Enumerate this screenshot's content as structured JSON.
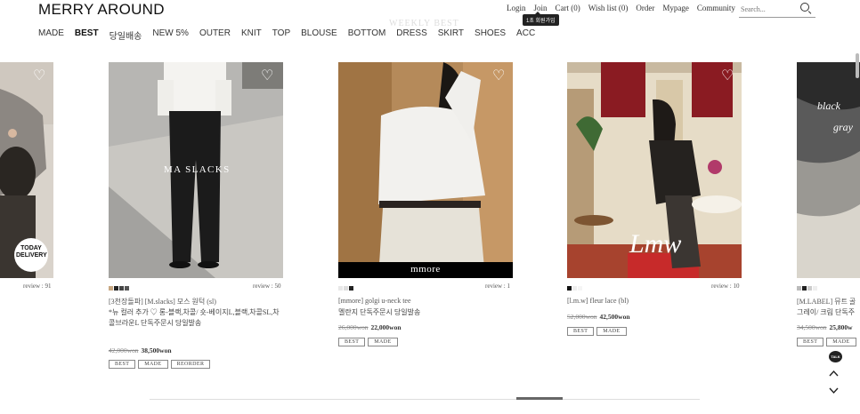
{
  "header": {
    "logo": "MERRY AROUND",
    "nav": [
      "MADE",
      "BEST",
      "당일배송",
      "NEW 5%",
      "OUTER",
      "KNIT",
      "TOP",
      "BLOUSE",
      "BOTTOM",
      "DRESS",
      "SKIRT",
      "SHOES",
      "ACC"
    ],
    "util": [
      "Login",
      "Join",
      "Cart (0)",
      "Wish list (0)",
      "Order",
      "Mypage",
      "Community"
    ],
    "coupon_tooltip": "1초 회원가입",
    "search_placeholder": "Search..."
  },
  "section_title": "WEEKLY BEST",
  "products": [
    {
      "review": "review : 91",
      "badge_text": "TODAY DELIVERY"
    },
    {
      "overlay": "MA SLACKS",
      "review": "review : 50",
      "swatches": [
        "#c8a882",
        "#222222",
        "#444444",
        "#555555"
      ],
      "name": "[3천장돌파] [M.slacks] 모스 원턱 (sl)",
      "desc": "*뉴 컬러 추가 ♡ 롱-블랙,차콜/ 숏-베이지L,블랙,차콜SL,차콜브라운L 단독주문시 당일발송",
      "price_old": "42,000won",
      "price": "38,500won",
      "tags": [
        "BEST",
        "MADE",
        "REORDER"
      ]
    },
    {
      "overlay": "mmore",
      "review": "review : 1",
      "swatches": [
        "#e8e8e8",
        "#dddddd",
        "#222222"
      ],
      "name": "[mmore] golgi u-neck tee",
      "desc": "멜란지 단독주문시 당일발송",
      "price_old": "26,000won",
      "price": "22,000won",
      "tags": [
        "BEST",
        "MADE"
      ]
    },
    {
      "overlay": "Lmw",
      "review": "review : 10",
      "swatches": [
        "#111111",
        "#eeeeee",
        "#f5f5f5"
      ],
      "name": "[l.m.w] fleur lace (bl)",
      "price_old": "52,000won",
      "price": "42,500won",
      "tags": [
        "BEST",
        "MADE"
      ]
    },
    {
      "overlay1": "black",
      "overlay2": "gray",
      "swatches": [
        "#bbbbbb",
        "#222222",
        "#cccccc",
        "#eeeeee"
      ],
      "name": "[M.LABEL] 뮤트 골",
      "desc": "그레이/ 크림 단독주",
      "price_old": "34,500won",
      "price": "25,800w",
      "tags": [
        "BEST",
        "MADE"
      ]
    }
  ],
  "talk_label": "TALK",
  "colors": {
    "accent": "#222222"
  }
}
